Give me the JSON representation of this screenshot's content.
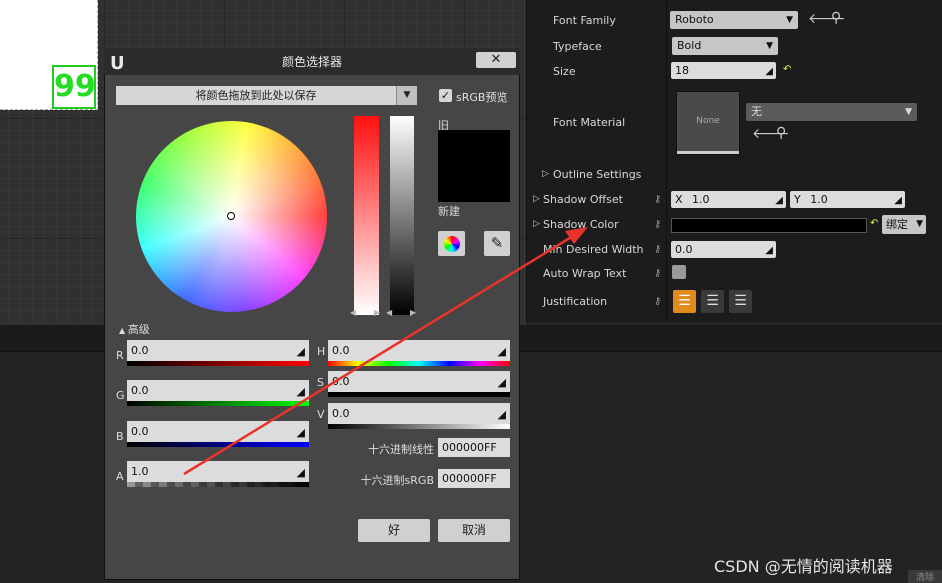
{
  "viewport": {
    "preview_text": "99"
  },
  "details": {
    "font_family": {
      "label": "Font Family",
      "value": "Roboto"
    },
    "typeface": {
      "label": "Typeface",
      "value": "Bold"
    },
    "size": {
      "label": "Size",
      "value": "18"
    },
    "font_material": {
      "label": "Font Material",
      "thumb_text": "None",
      "value": "无"
    },
    "outline_settings": {
      "label": "Outline Settings"
    },
    "shadow_offset": {
      "label": "Shadow Offset",
      "x_label": "X",
      "x_value": "1.0",
      "y_label": "Y",
      "y_value": "1.0"
    },
    "shadow_color": {
      "label": "Shadow Color",
      "bind_label": "绑定"
    },
    "min_desired_width": {
      "label": "Min Desired Width",
      "value": "0.0"
    },
    "auto_wrap_text": {
      "label": "Auto Wrap Text"
    },
    "justification": {
      "label": "Justification"
    }
  },
  "dialog": {
    "title": "颜色选择器",
    "save_bar_text": "将颜色拖放到此处以保存",
    "srgb_label": "sRGB预览",
    "old_label": "旧",
    "new_label": "新建",
    "advanced_label": "高级",
    "channels": {
      "r": {
        "label": "R",
        "value": "0.0"
      },
      "g": {
        "label": "G",
        "value": "0.0"
      },
      "b": {
        "label": "B",
        "value": "0.0"
      },
      "a": {
        "label": "A",
        "value": "1.0"
      },
      "h": {
        "label": "H",
        "value": "0.0"
      },
      "s": {
        "label": "S",
        "value": "0.0"
      },
      "v": {
        "label": "V",
        "value": "0.0"
      }
    },
    "hex_linear": {
      "label": "十六进制线性",
      "value": "000000FF"
    },
    "hex_srgb": {
      "label": "十六进制sRGB",
      "value": "000000FF"
    },
    "ok_label": "好",
    "cancel_label": "取消"
  },
  "status_text": "清除",
  "watermark": "CSDN @无情的阅读机器",
  "colors": {
    "accent_orange": "#e38a1c",
    "annotation_arrow": "#e8332b",
    "preview_green": "#22dd22",
    "shadow_color": "#000000"
  }
}
